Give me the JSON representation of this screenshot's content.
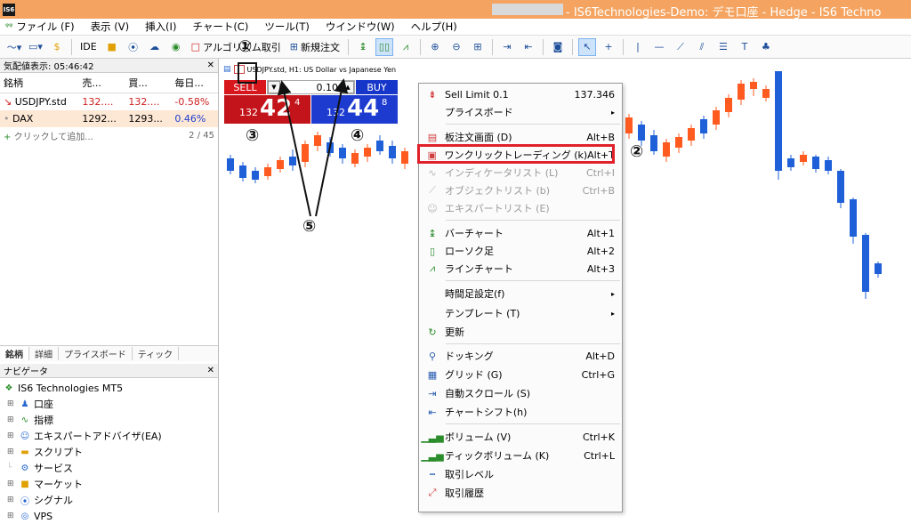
{
  "titlebar": {
    "app_icon": "IS6",
    "title": "- IS6Technologies-Demo: デモ口座 - Hedge - IS6 Techno"
  },
  "menu": [
    "ファイル (F)",
    "表示 (V)",
    "挿入(I)",
    "チャート(C)",
    "ツール(T)",
    "ウインドウ(W)",
    "ヘルプ(H)"
  ],
  "toolbar": {
    "ide_label": "IDE",
    "algo_label": "アルゴリズム取引",
    "new_order_label": "新規注文"
  },
  "market_watch": {
    "header": "気配値表示: 05:46:42",
    "columns": [
      "銘柄",
      "売...",
      "買...",
      "毎日..."
    ],
    "rows": [
      {
        "symbol": "USDJPY.std",
        "bid": "132....",
        "ask": "132....",
        "change": "-0.58%",
        "marker": "↘"
      },
      {
        "symbol": "DAX",
        "bid": "1292...",
        "ask": "1293...",
        "change": "0.46%",
        "marker": "•"
      }
    ],
    "add_label": "クリックして追加...",
    "count": "2 / 45",
    "tabs": [
      "銘柄",
      "詳細",
      "プライスボード",
      "ティック"
    ]
  },
  "navigator": {
    "header": "ナビゲータ",
    "root": "IS6 Technologies MT5",
    "items": [
      "口座",
      "指標",
      "エキスパートアドバイザ(EA)",
      "スクリプト",
      "サービス",
      "マーケット",
      "シグナル",
      "VPS"
    ]
  },
  "chart": {
    "label": "USDJPY.std, H1: US Dollar vs Japanese Yen"
  },
  "oneclick": {
    "sell_label": "SELL",
    "buy_label": "BUY",
    "volume": "0.10",
    "sell_small": "132",
    "sell_big": "42",
    "sell_sup": "4",
    "buy_small": "132",
    "buy_big": "44",
    "buy_sup": "8"
  },
  "context_menu": {
    "items": [
      {
        "label": "Sell Limit 0.1",
        "shortcut": "137.346",
        "icon": "sell-limit-icon",
        "disabled": false
      },
      {
        "label": "プライスボード",
        "shortcut": "▸",
        "icon": "",
        "disabled": false
      },
      {
        "label": "板注文画面 (D)",
        "shortcut": "Alt+B",
        "icon": "depth-icon",
        "disabled": false
      },
      {
        "label": "ワンクリックトレーディング (k)",
        "shortcut": "Alt+T",
        "icon": "one-click-icon",
        "disabled": false
      },
      {
        "label": "インディケータリスト (L)",
        "shortcut": "Ctrl+I",
        "icon": "indicator-icon",
        "disabled": true
      },
      {
        "label": "オブジェクトリスト (b)",
        "shortcut": "Ctrl+B",
        "icon": "object-icon",
        "disabled": true
      },
      {
        "label": "エキスパートリスト (E)",
        "shortcut": "",
        "icon": "expert-icon",
        "disabled": true
      },
      {
        "label": "バーチャート",
        "shortcut": "Alt+1",
        "icon": "bar-chart-icon",
        "disabled": false
      },
      {
        "label": "ローソク足",
        "shortcut": "Alt+2",
        "icon": "candle-icon",
        "disabled": false
      },
      {
        "label": "ラインチャート",
        "shortcut": "Alt+3",
        "icon": "line-chart-icon",
        "disabled": false
      },
      {
        "label": "時間足設定(f)",
        "shortcut": "▸",
        "icon": "",
        "disabled": false
      },
      {
        "label": "テンプレート (T)",
        "shortcut": "▸",
        "icon": "",
        "disabled": false
      },
      {
        "label": "更新",
        "shortcut": "",
        "icon": "refresh-icon",
        "disabled": false
      },
      {
        "label": "ドッキング",
        "shortcut": "Alt+D",
        "icon": "docking-icon",
        "disabled": false
      },
      {
        "label": "グリッド (G)",
        "shortcut": "Ctrl+G",
        "icon": "grid-icon",
        "disabled": false
      },
      {
        "label": "自動スクロール (S)",
        "shortcut": "",
        "icon": "autoscroll-icon",
        "disabled": false
      },
      {
        "label": "チャートシフト(h)",
        "shortcut": "",
        "icon": "chart-shift-icon",
        "disabled": false
      },
      {
        "label": "ボリューム (V)",
        "shortcut": "Ctrl+K",
        "icon": "volume-icon",
        "disabled": false
      },
      {
        "label": "ティックボリューム (K)",
        "shortcut": "Ctrl+L",
        "icon": "tick-volume-icon",
        "disabled": false
      },
      {
        "label": "取引レベル",
        "shortcut": "",
        "icon": "trade-levels-icon",
        "disabled": false
      },
      {
        "label": "取引履歴",
        "shortcut": "",
        "icon": "trade-history-icon",
        "disabled": false
      }
    ]
  },
  "annotations": [
    "①",
    "②",
    "③",
    "④",
    "⑤"
  ],
  "colors": {
    "title_bar": "#f4a460",
    "sell": "#d8171d",
    "buy": "#1636c9",
    "candle_up": "#ff5a1f",
    "candle_down": "#1f5fd8",
    "highlight": "#e0202a"
  }
}
